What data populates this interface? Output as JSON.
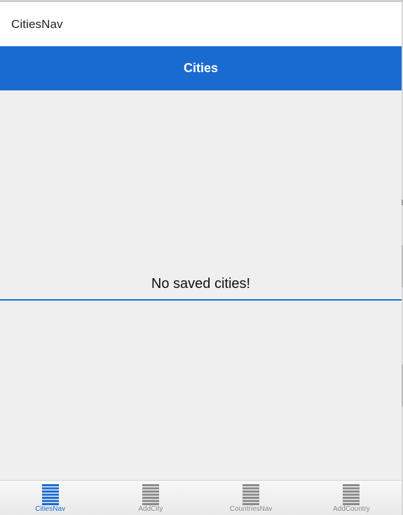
{
  "top_bar": {
    "title": "CitiesNav"
  },
  "header": {
    "title": "Cities",
    "color": "#1a6bd0"
  },
  "content": {
    "empty_message": "No saved cities!"
  },
  "tabbar": {
    "tabs": [
      {
        "label": "CitiesNav",
        "icon": "list-icon",
        "active": true
      },
      {
        "label": "AddCity",
        "icon": "list-icon",
        "active": false
      },
      {
        "label": "CountriesNav",
        "icon": "list-icon",
        "active": false
      },
      {
        "label": "AddCountry",
        "icon": "list-icon",
        "active": false
      }
    ],
    "active_color": "#1a6bd0",
    "inactive_color": "#8a8a8a"
  }
}
